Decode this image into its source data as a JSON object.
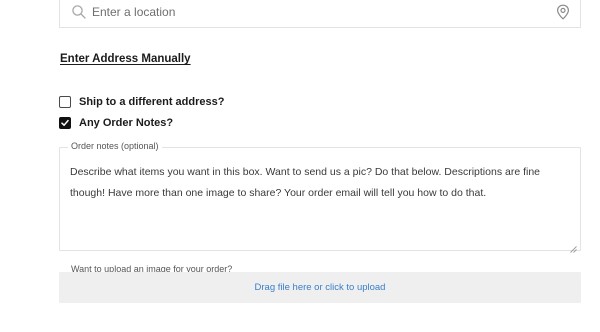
{
  "location": {
    "placeholder": "Enter a location",
    "value": ""
  },
  "manual_address": {
    "label": "Enter Address Manually"
  },
  "options": [
    {
      "label": "Ship to a different address?",
      "checked": false
    },
    {
      "label": "Any Order Notes?",
      "checked": true
    }
  ],
  "order_notes": {
    "legend": "Order notes (optional)",
    "value": "Describe what items you want in this box. Want to send us a pic? Do that below. Descriptions are fine though! Have more than one image to share? Your order email will tell you how to do that."
  },
  "upload": {
    "label": "Want to upload an image for your order?",
    "dropzone_text": "Drag file here or click to upload",
    "link_color": "#3a7ecb"
  },
  "icons": {
    "search": "search-icon",
    "location": "location-pin-icon",
    "checkmark": "check-icon"
  }
}
